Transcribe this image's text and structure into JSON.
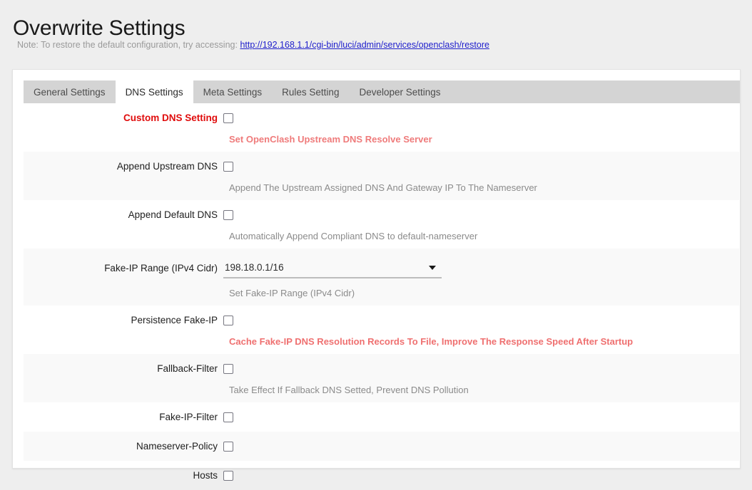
{
  "header": {
    "title": "Overwrite Settings",
    "note_prefix": "Note: To restore the default configuration, try accessing: ",
    "note_link": "http://192.168.1.1/cgi-bin/luci/admin/services/openclash/restore"
  },
  "tabs": [
    {
      "label": "General Settings",
      "active": false
    },
    {
      "label": "DNS Settings",
      "active": true
    },
    {
      "label": "Meta Settings",
      "active": false
    },
    {
      "label": "Rules Setting",
      "active": false
    },
    {
      "label": "Developer Settings",
      "active": false
    }
  ],
  "rows": [
    {
      "label": "Custom DNS Setting",
      "label_style": "alert",
      "control": "checkbox",
      "checked": false,
      "description": "Set OpenClash Upstream DNS Resolve Server",
      "desc_style": "alert-soft",
      "striped": false
    },
    {
      "label": "Append Upstream DNS",
      "label_style": "normal",
      "control": "checkbox",
      "checked": false,
      "description": "Append The Upstream Assigned DNS And Gateway IP To The Nameserver",
      "desc_style": "normal",
      "striped": true
    },
    {
      "label": "Append Default DNS",
      "label_style": "normal",
      "control": "checkbox",
      "checked": false,
      "description": "Automatically Append Compliant DNS to default-nameserver",
      "desc_style": "normal",
      "striped": false
    },
    {
      "label": "Fake-IP Range (IPv4 Cidr)",
      "label_style": "normal",
      "control": "select",
      "value": "198.18.0.1/16",
      "description": "Set Fake-IP Range (IPv4 Cidr)",
      "desc_style": "normal",
      "striped": true
    },
    {
      "label": "Persistence Fake-IP",
      "label_style": "normal",
      "control": "checkbox",
      "checked": false,
      "description": "Cache Fake-IP DNS Resolution Records To File, Improve The Response Speed After Startup",
      "desc_style": "alert-strong",
      "striped": false
    },
    {
      "label": "Fallback-Filter",
      "label_style": "normal",
      "control": "checkbox",
      "checked": false,
      "description": "Take Effect If Fallback DNS Setted, Prevent DNS Pollution",
      "desc_style": "normal",
      "striped": true
    },
    {
      "label": "Fake-IP-Filter",
      "label_style": "normal",
      "control": "checkbox",
      "checked": false,
      "description": "",
      "desc_style": "normal",
      "striped": false
    },
    {
      "label": "Nameserver-Policy",
      "label_style": "normal",
      "control": "checkbox",
      "checked": false,
      "description": "",
      "desc_style": "normal",
      "striped": true
    },
    {
      "label": "Hosts",
      "label_style": "normal",
      "control": "checkbox",
      "checked": false,
      "description": "",
      "desc_style": "normal",
      "striped": false
    }
  ]
}
